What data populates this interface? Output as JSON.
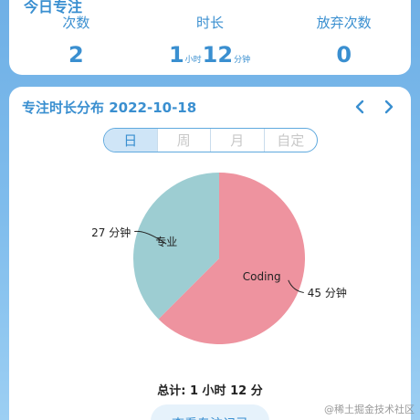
{
  "today_card": {
    "title": "今日专注",
    "stats": [
      {
        "label": "次数",
        "value": "2"
      },
      {
        "label": "时长",
        "hours": "1",
        "hours_unit": "小时",
        "minutes": "12",
        "minutes_unit": "分钟"
      },
      {
        "label": "放弃次数",
        "value": "0"
      }
    ]
  },
  "distribution": {
    "title": "专注时长分布 2022-10-18",
    "prev_icon": "chevron-left-icon",
    "next_icon": "chevron-right-icon",
    "tabs": [
      {
        "label": "日",
        "active": true
      },
      {
        "label": "周",
        "active": false
      },
      {
        "label": "月",
        "active": false
      },
      {
        "label": "自定",
        "active": false
      }
    ]
  },
  "chart_data": {
    "type": "pie",
    "categories": [
      "Coding",
      "专业"
    ],
    "values": [
      45,
      27
    ],
    "data_labels": [
      "45 分钟",
      "27 分钟"
    ],
    "colors": [
      "#ee939f",
      "#9dcdd2"
    ]
  },
  "summary": {
    "total": "总计: 1 小时 12 分",
    "records_button": "查看专注记录"
  },
  "watermark": "@稀土掘金技术社区",
  "colors": {
    "accent": "#3a8fd0"
  }
}
